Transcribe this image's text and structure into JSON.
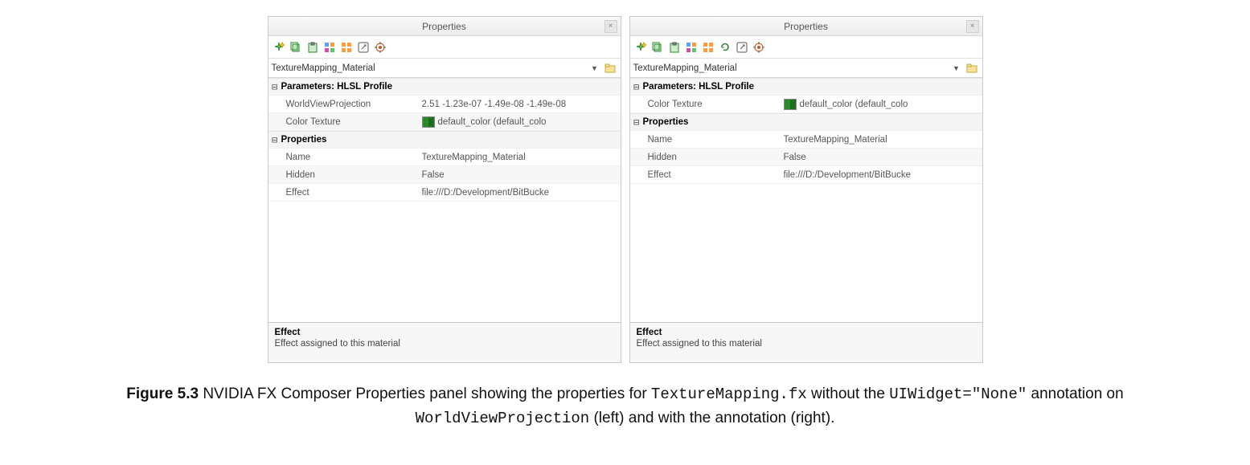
{
  "common": {
    "panel_title": "Properties",
    "selector_value": "TextureMapping_Material",
    "section_params": "Parameters: HLSL Profile",
    "section_props": "Properties",
    "row_world": "WorldViewProjection",
    "row_color": "Color Texture",
    "row_name": "Name",
    "row_hidden": "Hidden",
    "row_effect": "Effect",
    "val_world": "2.51 -1.23e-07 -1.49e-08 -1.49e-08",
    "val_color": "default_color (default_colo",
    "val_name": "TextureMapping_Material",
    "val_hidden": "False",
    "val_effect": "file:///D:/Development/BitBucke",
    "desc_title": "Effect",
    "desc_body": "Effect assigned to this material"
  },
  "caption": {
    "fig": "Figure 5.3",
    "t1": " NVIDIA FX Composer Properties panel showing the properties for ",
    "c1": "TextureMapping.fx",
    "t2": " without the ",
    "c2": "UIWidget=\"None\"",
    "t3": " annotation on ",
    "c3": "WorldViewProjection",
    "t4": " (left) and with the annotation (right)."
  }
}
